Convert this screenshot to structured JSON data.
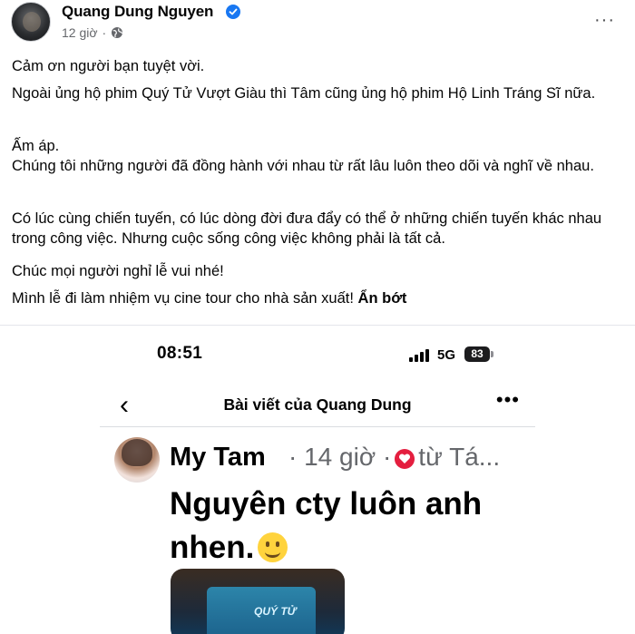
{
  "post": {
    "author": "Quang Dung Nguyen",
    "time": "12 giờ",
    "dot": "·",
    "more": "···",
    "paragraphs": {
      "p1": "Cảm ơn người bạn tuyệt vời.",
      "p2": "Ngoài ủng hộ phim Quý Tử Vượt Giàu thì Tâm cũng ủng hộ phim Hộ Linh Tráng Sĩ nữa.",
      "p3": "Ấm áp.",
      "p4": "Chúng tôi những người đã đồng hành với nhau từ rất lâu luôn theo dõi và nghĩ về nhau.",
      "p5": "Có lúc cùng chiến tuyến, có lúc dòng đời đưa đẩy có thể ở những chiến tuyến khác nhau trong công việc. Nhưng cuộc sống công việc không phải là tất cả.",
      "p6": "Chúc mọi người nghỉ lễ vui nhé!",
      "p7": "Mình lễ đi làm nhiệm vụ cine tour cho nhà sản xuất!"
    },
    "see_less": "Ẩn bớt"
  },
  "screenshot": {
    "status": {
      "time": "08:51",
      "network": "5G",
      "battery": "83"
    },
    "nav": {
      "title": "Bài viết của Quang Dung",
      "back": "‹",
      "more": "•••"
    },
    "inner_post": {
      "author": "My Tam",
      "meta_time": "· 14 giờ ·",
      "meta_location": "từ Tá...",
      "text": "Nguyên cty luôn anh nhen.",
      "photo_text": "QUÝ TỬ"
    }
  },
  "colors": {
    "verified": "#1877f2",
    "meta_gray": "#65676b",
    "heart_red": "#e41e3f"
  }
}
